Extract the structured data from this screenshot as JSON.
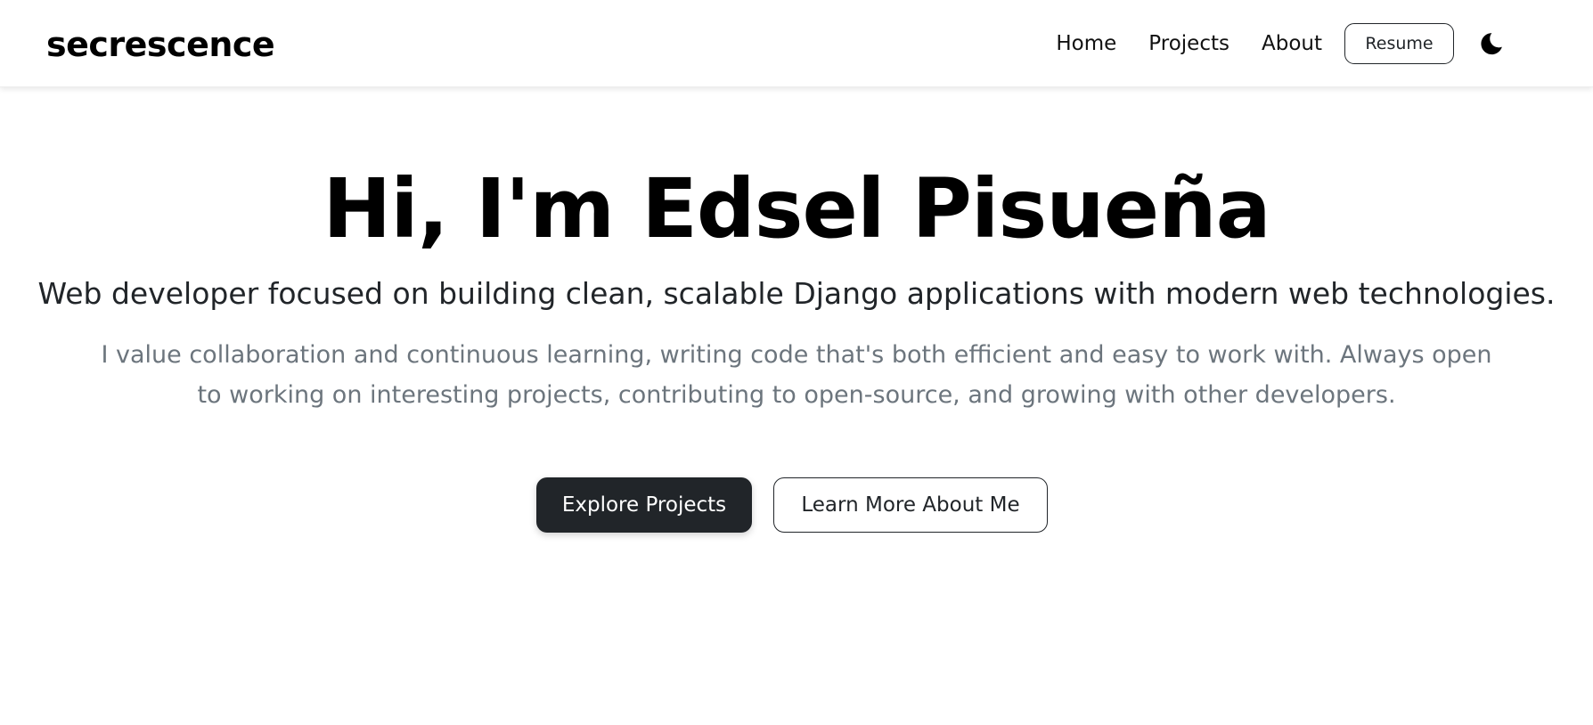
{
  "navbar": {
    "brand": "secrescence",
    "links": [
      {
        "label": "Home"
      },
      {
        "label": "Projects"
      },
      {
        "label": "About"
      }
    ],
    "resume_label": "Resume",
    "theme_icon": "moon-icon"
  },
  "hero": {
    "title": "Hi, I'm Edsel Pisueña",
    "subtitle": "Web developer focused on building clean, scalable Django applications with modern web technologies.",
    "description": "I value collaboration and continuous learning, writing code that's both efficient and easy to work with. Always open to working on interesting projects, contributing to open-source, and growing with other developers.",
    "primary_cta": "Explore Projects",
    "secondary_cta": "Learn More About Me"
  },
  "colors": {
    "primary_button_bg": "#212529",
    "muted_text": "#6c757d",
    "background": "#ffffff"
  }
}
